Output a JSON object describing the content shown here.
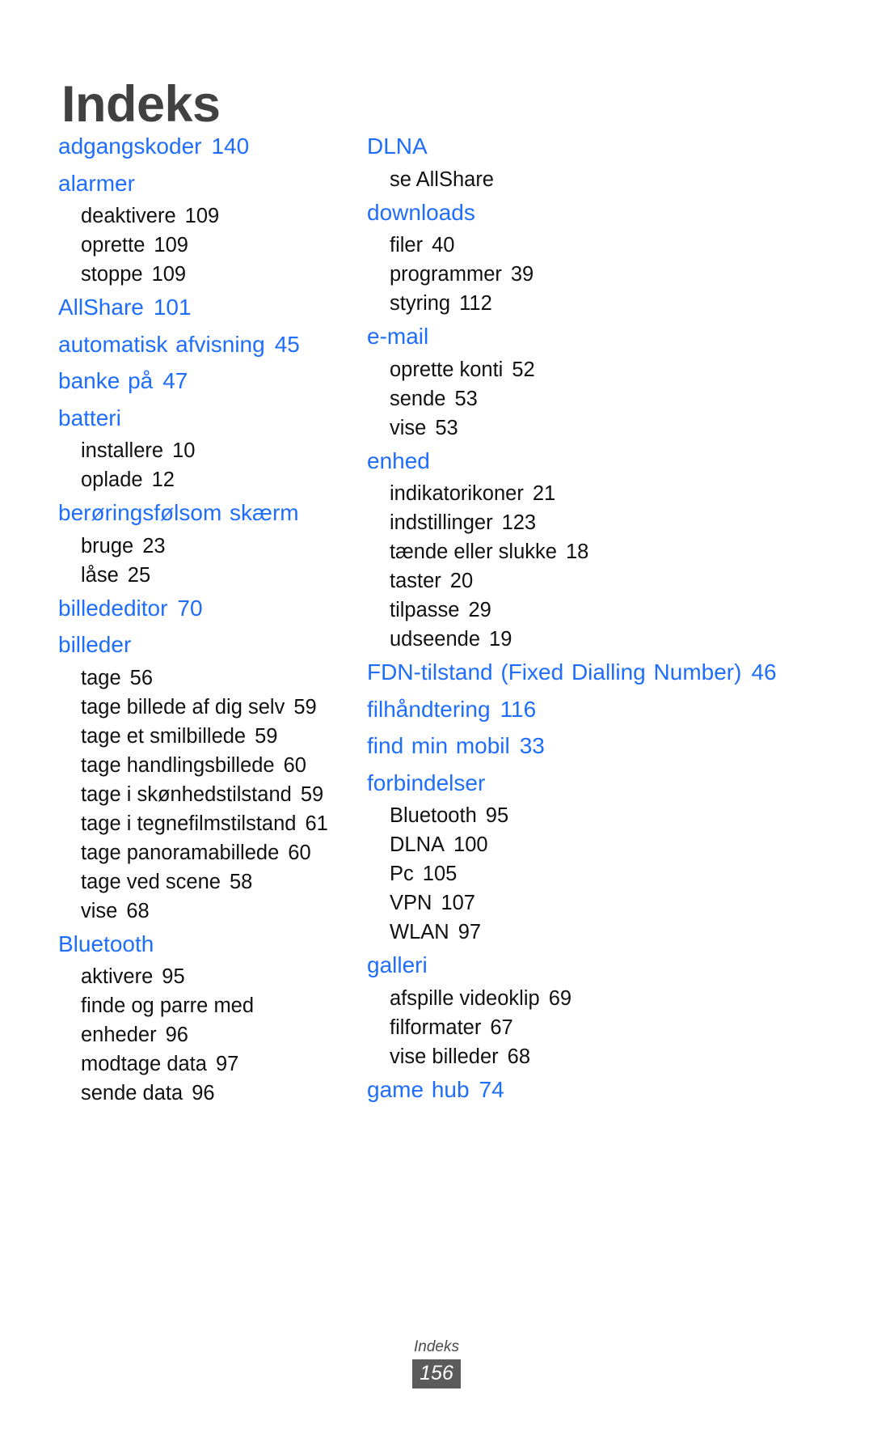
{
  "page": {
    "title": "Indeks",
    "footer_label": "Indeks",
    "page_number": "156",
    "colors": {
      "entry_blue": "#1f6dfb",
      "title_gray": "#414141",
      "page_badge_bg": "#5b5b5b",
      "subentry_black": "#111111"
    }
  },
  "columns": [
    {
      "id": "left",
      "entries": [
        {
          "term": "adgangskoder",
          "page": "140",
          "sub": []
        },
        {
          "term": "alarmer",
          "page": "",
          "sub": [
            {
              "term": "deaktivere",
              "page": "109"
            },
            {
              "term": "oprette",
              "page": "109"
            },
            {
              "term": "stoppe",
              "page": "109"
            }
          ]
        },
        {
          "term": "AllShare",
          "page": "101",
          "sub": []
        },
        {
          "term": "automatisk afvisning",
          "page": "45",
          "sub": []
        },
        {
          "term": "banke på",
          "page": "47",
          "sub": []
        },
        {
          "term": "batteri",
          "page": "",
          "sub": [
            {
              "term": "installere",
              "page": "10"
            },
            {
              "term": "oplade",
              "page": "12"
            }
          ]
        },
        {
          "term": "berøringsfølsom skærm",
          "page": "",
          "sub": [
            {
              "term": "bruge",
              "page": "23"
            },
            {
              "term": "låse",
              "page": "25"
            }
          ]
        },
        {
          "term": "billededitor",
          "page": "70",
          "sub": []
        },
        {
          "term": "billeder",
          "page": "",
          "sub": [
            {
              "term": "tage",
              "page": "56"
            },
            {
              "term": "tage billede af dig selv",
              "page": "59"
            },
            {
              "term": "tage et smilbillede",
              "page": "59"
            },
            {
              "term": "tage handlingsbillede",
              "page": "60"
            },
            {
              "term": "tage i skønhedstilstand",
              "page": "59"
            },
            {
              "term": "tage i tegnefilmstilstand",
              "page": "61"
            },
            {
              "term": "tage panoramabillede",
              "page": "60"
            },
            {
              "term": "tage ved scene",
              "page": "58"
            },
            {
              "term": "vise",
              "page": "68"
            }
          ]
        },
        {
          "term": "Bluetooth",
          "page": "",
          "sub": [
            {
              "term": "aktivere",
              "page": "95"
            },
            {
              "term": "finde og parre med enheder",
              "page": "96"
            },
            {
              "term": "modtage data",
              "page": "97"
            },
            {
              "term": "sende data",
              "page": "96"
            }
          ]
        }
      ]
    },
    {
      "id": "right",
      "entries": [
        {
          "term": "DLNA",
          "page": "",
          "sub": [
            {
              "term": "se AllShare",
              "page": ""
            }
          ]
        },
        {
          "term": "downloads",
          "page": "",
          "sub": [
            {
              "term": "filer",
              "page": "40"
            },
            {
              "term": "programmer",
              "page": "39"
            },
            {
              "term": "styring",
              "page": "112"
            }
          ]
        },
        {
          "term": "e-mail",
          "page": "",
          "sub": [
            {
              "term": "oprette konti",
              "page": "52"
            },
            {
              "term": "sende",
              "page": "53"
            },
            {
              "term": "vise",
              "page": "53"
            }
          ]
        },
        {
          "term": "enhed",
          "page": "",
          "sub": [
            {
              "term": "indikatorikoner",
              "page": "21"
            },
            {
              "term": "indstillinger",
              "page": "123"
            },
            {
              "term": "tænde eller slukke",
              "page": "18"
            },
            {
              "term": "taster",
              "page": "20"
            },
            {
              "term": "tilpasse",
              "page": "29"
            },
            {
              "term": "udseende",
              "page": "19"
            }
          ]
        },
        {
          "term": "FDN-tilstand (Fixed Dialling Number)",
          "page": "46",
          "sub": []
        },
        {
          "term": "filhåndtering",
          "page": "116",
          "sub": []
        },
        {
          "term": "find min mobil",
          "page": "33",
          "sub": []
        },
        {
          "term": "forbindelser",
          "page": "",
          "sub": [
            {
              "term": "Bluetooth",
              "page": "95"
            },
            {
              "term": "DLNA",
              "page": "100"
            },
            {
              "term": "Pc",
              "page": "105"
            },
            {
              "term": "VPN",
              "page": "107"
            },
            {
              "term": "WLAN",
              "page": "97"
            }
          ]
        },
        {
          "term": "galleri",
          "page": "",
          "sub": [
            {
              "term": "afspille videoklip",
              "page": "69"
            },
            {
              "term": "filformater",
              "page": "67"
            },
            {
              "term": "vise billeder",
              "page": "68"
            }
          ]
        },
        {
          "term": "game hub",
          "page": "74",
          "sub": []
        }
      ]
    }
  ]
}
